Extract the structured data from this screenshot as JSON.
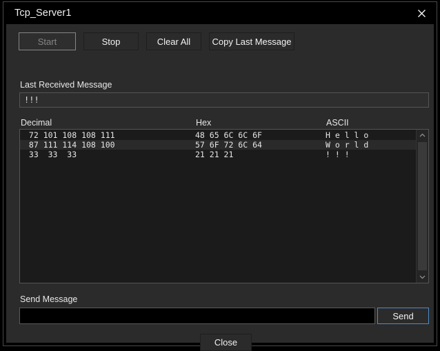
{
  "window": {
    "title": "Tcp_Server1",
    "close_icon": "close-icon"
  },
  "toolbar": {
    "start_label": "Start",
    "stop_label": "Stop",
    "clear_all_label": "Clear All",
    "copy_last_message_label": "Copy Last Message"
  },
  "last_received": {
    "label": "Last Received Message",
    "value": "!!!"
  },
  "table": {
    "headers": {
      "decimal": "Decimal",
      "hex": "Hex",
      "ascii": "ASCII"
    },
    "rows": [
      {
        "decimal": " 72 101 108 108 111",
        "hex": "48 65 6C 6C 6F",
        "ascii": "H e l l o"
      },
      {
        "decimal": " 87 111 114 108 100",
        "hex": "57 6F 72 6C 64",
        "ascii": "W o r l d"
      },
      {
        "decimal": " 33  33  33",
        "hex": "21 21 21",
        "ascii": "! ! !"
      }
    ]
  },
  "scrollbar": {
    "up_icon": "chevron-up-icon",
    "down_icon": "chevron-down-icon"
  },
  "send": {
    "label": "Send Message",
    "value": "",
    "placeholder": "",
    "button_label": "Send"
  },
  "footer": {
    "close_label": "Close"
  },
  "colors": {
    "window_background": "#000000",
    "panel_background": "#2b2b2b",
    "list_background": "#1b1b1b",
    "alt_row_background": "#2a2a2a",
    "text": "#f0f0f0",
    "disabled_text": "#868686",
    "accent_focus": "#4f8cc9",
    "input_focus_background": "#000000"
  }
}
